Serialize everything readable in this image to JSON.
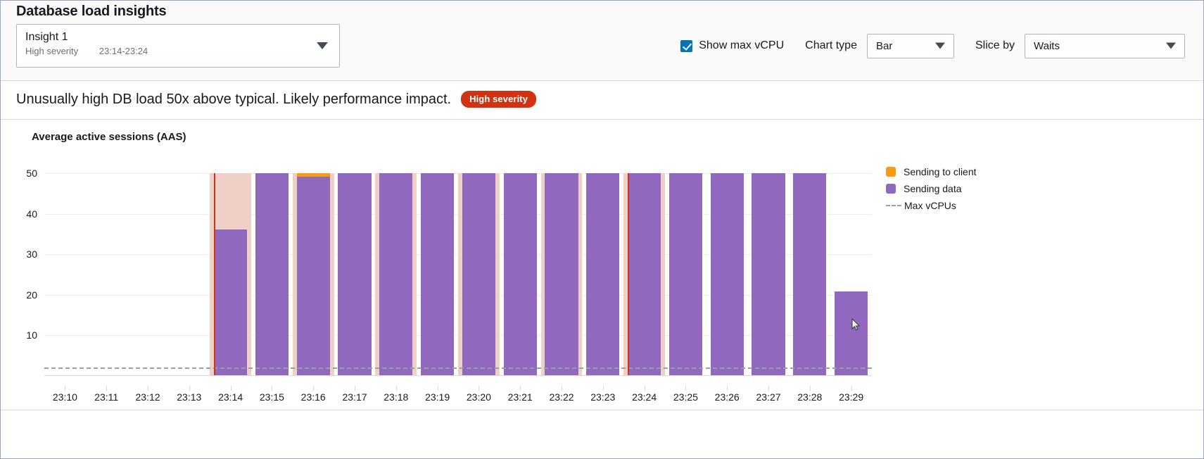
{
  "header": {
    "title": "Database load insights"
  },
  "insight_selector": {
    "name": "Insight 1",
    "severity": "High severity",
    "time_range": "23:14-23:24",
    "caret_icon": "chevron-down-icon"
  },
  "toolbar": {
    "show_max_vcpu_label": "Show max vCPU",
    "show_max_vcpu_checked": true,
    "chart_type_label": "Chart type",
    "chart_type_value": "Bar",
    "slice_by_label": "Slice by",
    "slice_by_value": "Waits"
  },
  "message": {
    "text": "Unusually high DB load 50x above typical. Likely performance impact.",
    "badge": "High severity",
    "badge_color": "#d13212"
  },
  "colors": {
    "sending_to_client": "#f89b12",
    "sending_data": "#9068be",
    "max_vcpu_line": "#95a0a8",
    "insight_band": "#efd0c7",
    "insight_boundary": "#c9341a",
    "checkbox_accent": "#0073bb"
  },
  "legend": [
    {
      "label": "Sending to client",
      "swatch": "#f89b12",
      "type": "swatch"
    },
    {
      "label": "Sending data",
      "swatch": "#9068be",
      "type": "swatch"
    },
    {
      "label": "Max vCPUs",
      "swatch": "#95a0a8",
      "type": "dash"
    }
  ],
  "chart_data": {
    "type": "bar",
    "title": "Average active sessions (AAS)",
    "xlabel": "",
    "ylabel": "",
    "ylim": [
      0,
      50
    ],
    "yticks": [
      10,
      20,
      30,
      40,
      50
    ],
    "grid": true,
    "stacked": true,
    "legend_position": "right",
    "categories": [
      "23:10",
      "23:11",
      "23:12",
      "23:13",
      "23:14",
      "23:15",
      "23:16",
      "23:17",
      "23:18",
      "23:19",
      "23:20",
      "23:21",
      "23:22",
      "23:23",
      "23:24",
      "23:25",
      "23:26",
      "23:27",
      "23:28",
      "23:29"
    ],
    "series": [
      {
        "name": "Sending data",
        "color": "#9068be",
        "values": [
          0,
          0,
          0,
          0,
          36.2,
          50,
          49.2,
          50,
          50,
          50,
          50,
          50,
          50,
          50,
          50,
          50,
          50,
          50,
          50,
          20.8
        ]
      },
      {
        "name": "Sending to client",
        "color": "#f89b12",
        "values": [
          0,
          0,
          0,
          0,
          0,
          0,
          0.8,
          0,
          0,
          0,
          0,
          0,
          0,
          0,
          0,
          0,
          0,
          0,
          0,
          0
        ]
      }
    ],
    "max_vcpus_line": 2,
    "insight_window": {
      "start": "23:14",
      "end": "23:24"
    },
    "highlight_bands": [
      "23:14",
      "23:16",
      "23:18",
      "23:20",
      "23:22",
      "23:24"
    ],
    "annotations": [
      {
        "type": "vline",
        "x": "23:14",
        "color": "#c9341a"
      },
      {
        "type": "vline",
        "x": "23:24",
        "color": "#c9341a"
      }
    ]
  }
}
